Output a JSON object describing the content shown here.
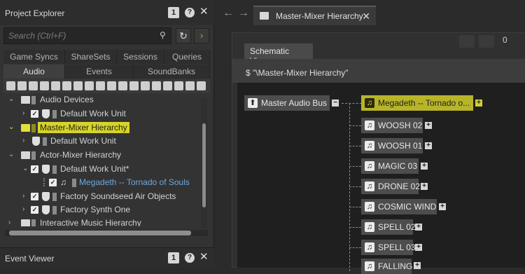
{
  "project_explorer": {
    "title": "Project Explorer",
    "badge": "1",
    "help": "?",
    "close": "✕",
    "search_placeholder": "Search (Ctrl+F)",
    "tabs_row1": [
      "Game Syncs",
      "ShareSets",
      "Sessions",
      "Queries"
    ],
    "tabs_row2": [
      "Audio",
      "Events",
      "SoundBanks"
    ],
    "active_tab": "Audio",
    "tree": [
      {
        "label": "Audio Devices"
      },
      {
        "label": "Default Work Unit"
      },
      {
        "label": "Master-Mixer Hierarchy",
        "highlighted": true
      },
      {
        "label": "Default Work Unit"
      },
      {
        "label": "Actor-Mixer Hierarchy"
      },
      {
        "label": "Default Work Unit*"
      },
      {
        "label": "Megadeth -- Tornado of Souls",
        "selected": true
      },
      {
        "label": "Factory Soundseed Air Objects"
      },
      {
        "label": "Factory Synth One"
      },
      {
        "label": "Interactive Music Hierarchy"
      }
    ]
  },
  "event_viewer": {
    "title": "Event Viewer",
    "badge": "1",
    "help": "?",
    "close": "✕"
  },
  "document": {
    "tab_title": "Master-Mixer Hierarchy",
    "tab_close": "✕",
    "back": "←",
    "forward": "→",
    "schematic_header": "Schematic View",
    "path": "$ \"\\Master-Mixer Hierarchy\"",
    "top_right_count": "0"
  },
  "schematic": {
    "root": "Master Audio Bus",
    "children": [
      {
        "label": "Megadeth -- Tornado o...",
        "highlighted": true
      },
      {
        "label": "WOOSH 02"
      },
      {
        "label": "WOOSH 01"
      },
      {
        "label": "MAGIC 03"
      },
      {
        "label": "DRONE 02"
      },
      {
        "label": "COSMIC WIND"
      },
      {
        "label": "SPELL 02"
      },
      {
        "label": "SPELL 03"
      },
      {
        "label": "FALLING"
      }
    ]
  },
  "colors": {
    "highlight": "#d7d42a",
    "selected_text": "#6fa8dc",
    "panel_bg": "#333333"
  }
}
